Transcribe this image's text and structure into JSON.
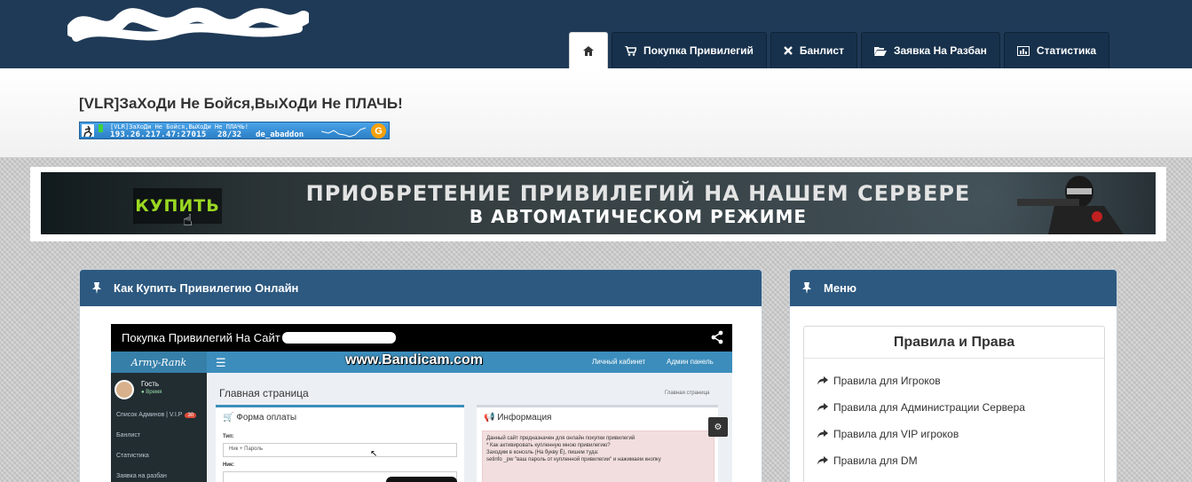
{
  "navbar": {
    "tabs": [
      {
        "label": "",
        "icon": "home-icon",
        "active": true
      },
      {
        "label": "Покупка Привилегий",
        "icon": "cart-icon",
        "active": false
      },
      {
        "label": "Банлист",
        "icon": "close-icon",
        "active": false
      },
      {
        "label": "Заявка На Разбан",
        "icon": "folder-open-icon",
        "active": false
      },
      {
        "label": "Статистика",
        "icon": "bar-chart-icon",
        "active": false
      }
    ]
  },
  "header": {
    "title": "[VLR]ЗаХоДи Не Бойся,ВыХоДи Не ПЛАЧЬ!",
    "server_banner": {
      "name": "[VLR]ЗаХоДи Не Бойся,ВыХоДи Не ПЛАЧЬ!",
      "address": "193.26.217.47:27015",
      "players": "28/32",
      "map": "de_abaddon"
    }
  },
  "promo": {
    "buy_label": "КУПИТЬ",
    "line1": "ПРИОБРЕТЕНИЕ ПРИВИЛЕГИЙ НА НАШЕМ СЕРВЕРЕ",
    "line2": "В АВТОМАТИЧЕСКОМ РЕЖИМЕ"
  },
  "left_panel": {
    "title": "Как Купить Привилегию Онлайн",
    "video": {
      "title": "Покупка Привилегий На Сайт",
      "frame": {
        "brand": "Army-Rank",
        "watermark": "www.Bandicam.com",
        "cabinet": "Личный кабинет",
        "admin": "Админ панель",
        "guest": "Гость",
        "online": "● Время",
        "sidebar": [
          {
            "label": "Список Админов | V.I.P",
            "badge": "30"
          },
          {
            "label": "Банлист",
            "badge": ""
          },
          {
            "label": "Статистика",
            "badge": ""
          },
          {
            "label": "Заявка на разбан",
            "badge": ""
          }
        ],
        "page_title": "Главная страница",
        "breadcrumb": "Главная страница",
        "payment_title": "Форма оплаты",
        "type_label": "Тип:",
        "type_value": "Ник + Пароль",
        "nick_label": "Ник:",
        "info_title": "Информация",
        "info_lines": [
          "Данный сайт предназначен для онлайн покупки привилегий",
          "* Как активировать купленную мною привилегию?",
          "Заходим в консоль (На букву Ё), пишем туда:",
          "setinfo _pw \"ваш пароль от купленной привилегии\" и нажимаем кнопку"
        ]
      }
    }
  },
  "right_panel": {
    "title": "Меню",
    "card_title": "Правила и Права",
    "items": [
      "Правила для Игроков",
      "Правила для Администрации Сервера",
      "Правила для VIP игроков",
      "Правила для DM"
    ]
  }
}
